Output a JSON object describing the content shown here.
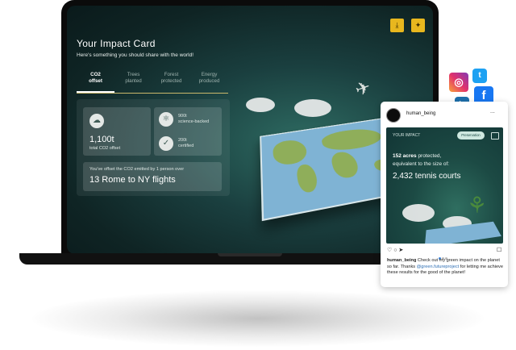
{
  "header": {
    "title": "Your Impact Card",
    "subtitle": "Here's something you should share with the world!"
  },
  "tabs": [
    {
      "line1": "CO2",
      "line2": "offset",
      "active": true
    },
    {
      "line1": "Trees",
      "line2": "planted",
      "active": false
    },
    {
      "line1": "Forest",
      "line2": "protected",
      "active": false
    },
    {
      "line1": "Energy",
      "line2": "produced",
      "active": false
    }
  ],
  "stats": {
    "total": {
      "value": "1,100t",
      "label": "total CO2 offset",
      "icon": "cloud-icon"
    },
    "science": {
      "value": "900t",
      "label": "science-backed",
      "icon": "atom-icon"
    },
    "certified": {
      "value": "200t",
      "label": "certified",
      "icon": "check-seal-icon"
    },
    "offset_line": "You've offset the CO2 emitted by 1 person over",
    "offset_big": "13 Rome to NY flights"
  },
  "actions": {
    "download_icon": "download-icon",
    "share_icon": "share-icon"
  },
  "post": {
    "username": "human_being",
    "more": "...",
    "image": {
      "header": "YOUR IMPACT",
      "badge": "Preservation",
      "line1_bold": "152 acres",
      "line1_rest": " protected,",
      "line2": "equivalent to the size of:",
      "big": "2,432 tennis courts"
    },
    "caption_user": "human_being",
    "caption_text1": " Check out my green impact on the planet so far. Thanks ",
    "caption_mention": "@green.futureproject",
    "caption_text2": " for letting me achieve these results for the good of the planet!"
  },
  "social": {
    "instagram": "instagram-icon",
    "twitter": "twitter-icon",
    "linkedin": "linkedin-icon",
    "facebook": "facebook-icon"
  },
  "colors": {
    "accent": "#e8b71e",
    "bg_dark": "#0f2424",
    "link": "#2f6fb4"
  }
}
